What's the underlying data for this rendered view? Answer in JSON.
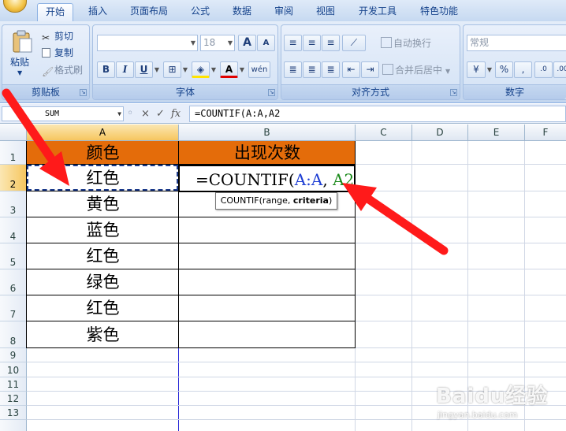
{
  "tabs": [
    "开始",
    "插入",
    "页面布局",
    "公式",
    "数据",
    "审阅",
    "视图",
    "开发工具",
    "特色功能"
  ],
  "active_tab": "开始",
  "clipboard": {
    "paste": "粘贴",
    "cut": "剪切",
    "copy": "复制",
    "format_painter": "格式刷",
    "label": "剪贴板"
  },
  "font": {
    "name": "",
    "size": "18",
    "bold": "B",
    "italic": "I",
    "underline": "U",
    "grow": "A",
    "shrink": "A",
    "label": "字体",
    "phonetic": "wén"
  },
  "alignment": {
    "wrap": "自动换行",
    "merge": "合并后居中",
    "label": "对齐方式"
  },
  "number": {
    "format": "常规",
    "percent": "%",
    "comma": ",",
    "label": "数字"
  },
  "formula_bar": {
    "name_box": "SUM",
    "cancel": "×",
    "enter": "✓",
    "fx": "fx",
    "content": "=COUNTIF(A:A,A2"
  },
  "columns": [
    "A",
    "B",
    "C",
    "D",
    "E",
    "F"
  ],
  "rows": [
    "1",
    "2",
    "3",
    "4",
    "5",
    "6",
    "7",
    "8",
    "9",
    "10",
    "11",
    "12",
    "13"
  ],
  "table": {
    "header_a": "颜色",
    "header_b": "出现次数",
    "colors": [
      "红色",
      "黄色",
      "蓝色",
      "红色",
      "绿色",
      "红色",
      "紫色"
    ]
  },
  "editing": {
    "prefix": "=COUNTIF(",
    "ref1": "A:A",
    "sep": ", ",
    "ref2": "A2"
  },
  "tooltip": {
    "func": "COUNTIF(range, ",
    "arg": "criteria",
    ")": ")"
  },
  "watermark": {
    "main": "Baidu经验",
    "sub": "jingyan.baidu.com"
  },
  "accent_colors": {
    "header_fill": "#e46c0a",
    "annotation_arrow": "#ff1a1a",
    "ref_blue": "#1f3fd4",
    "ref_green": "#1a8a1a"
  }
}
